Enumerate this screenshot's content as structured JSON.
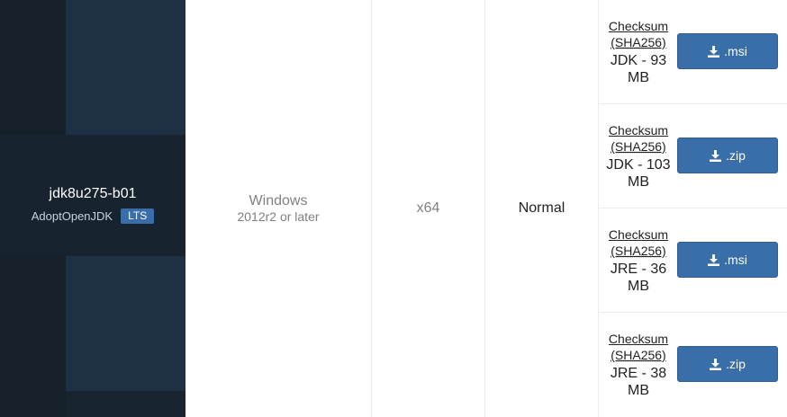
{
  "release": {
    "name": "jdk8u275-b01",
    "vendor": "AdoptOpenJDK",
    "badge": "LTS"
  },
  "os": {
    "name": "Windows",
    "version": "2012r2 or later"
  },
  "architecture": "x64",
  "heap": "Normal",
  "downloads": [
    {
      "checksum_line1": "Checksum",
      "checksum_line2": "(SHA256)",
      "size_line1": "JDK - 93",
      "size_line2": "MB",
      "button_label": ".msi",
      "icon": "download-icon"
    },
    {
      "checksum_line1": "Checksum",
      "checksum_line2": "(SHA256)",
      "size_line1": "JDK - 103",
      "size_line2": "MB",
      "button_label": ".zip",
      "icon": "download-icon"
    },
    {
      "checksum_line1": "Checksum",
      "checksum_line2": "(SHA256)",
      "size_line1": "JRE - 36",
      "size_line2": "MB",
      "button_label": ".msi",
      "icon": "download-icon"
    },
    {
      "checksum_line1": "Checksum",
      "checksum_line2": "(SHA256)",
      "size_line1": "JRE - 38",
      "size_line2": "MB",
      "button_label": ".zip",
      "icon": "download-icon"
    }
  ],
  "colors": {
    "release_bg": "#1a2733",
    "button": "#3a6ea8",
    "badge": "#3a6ea8"
  }
}
